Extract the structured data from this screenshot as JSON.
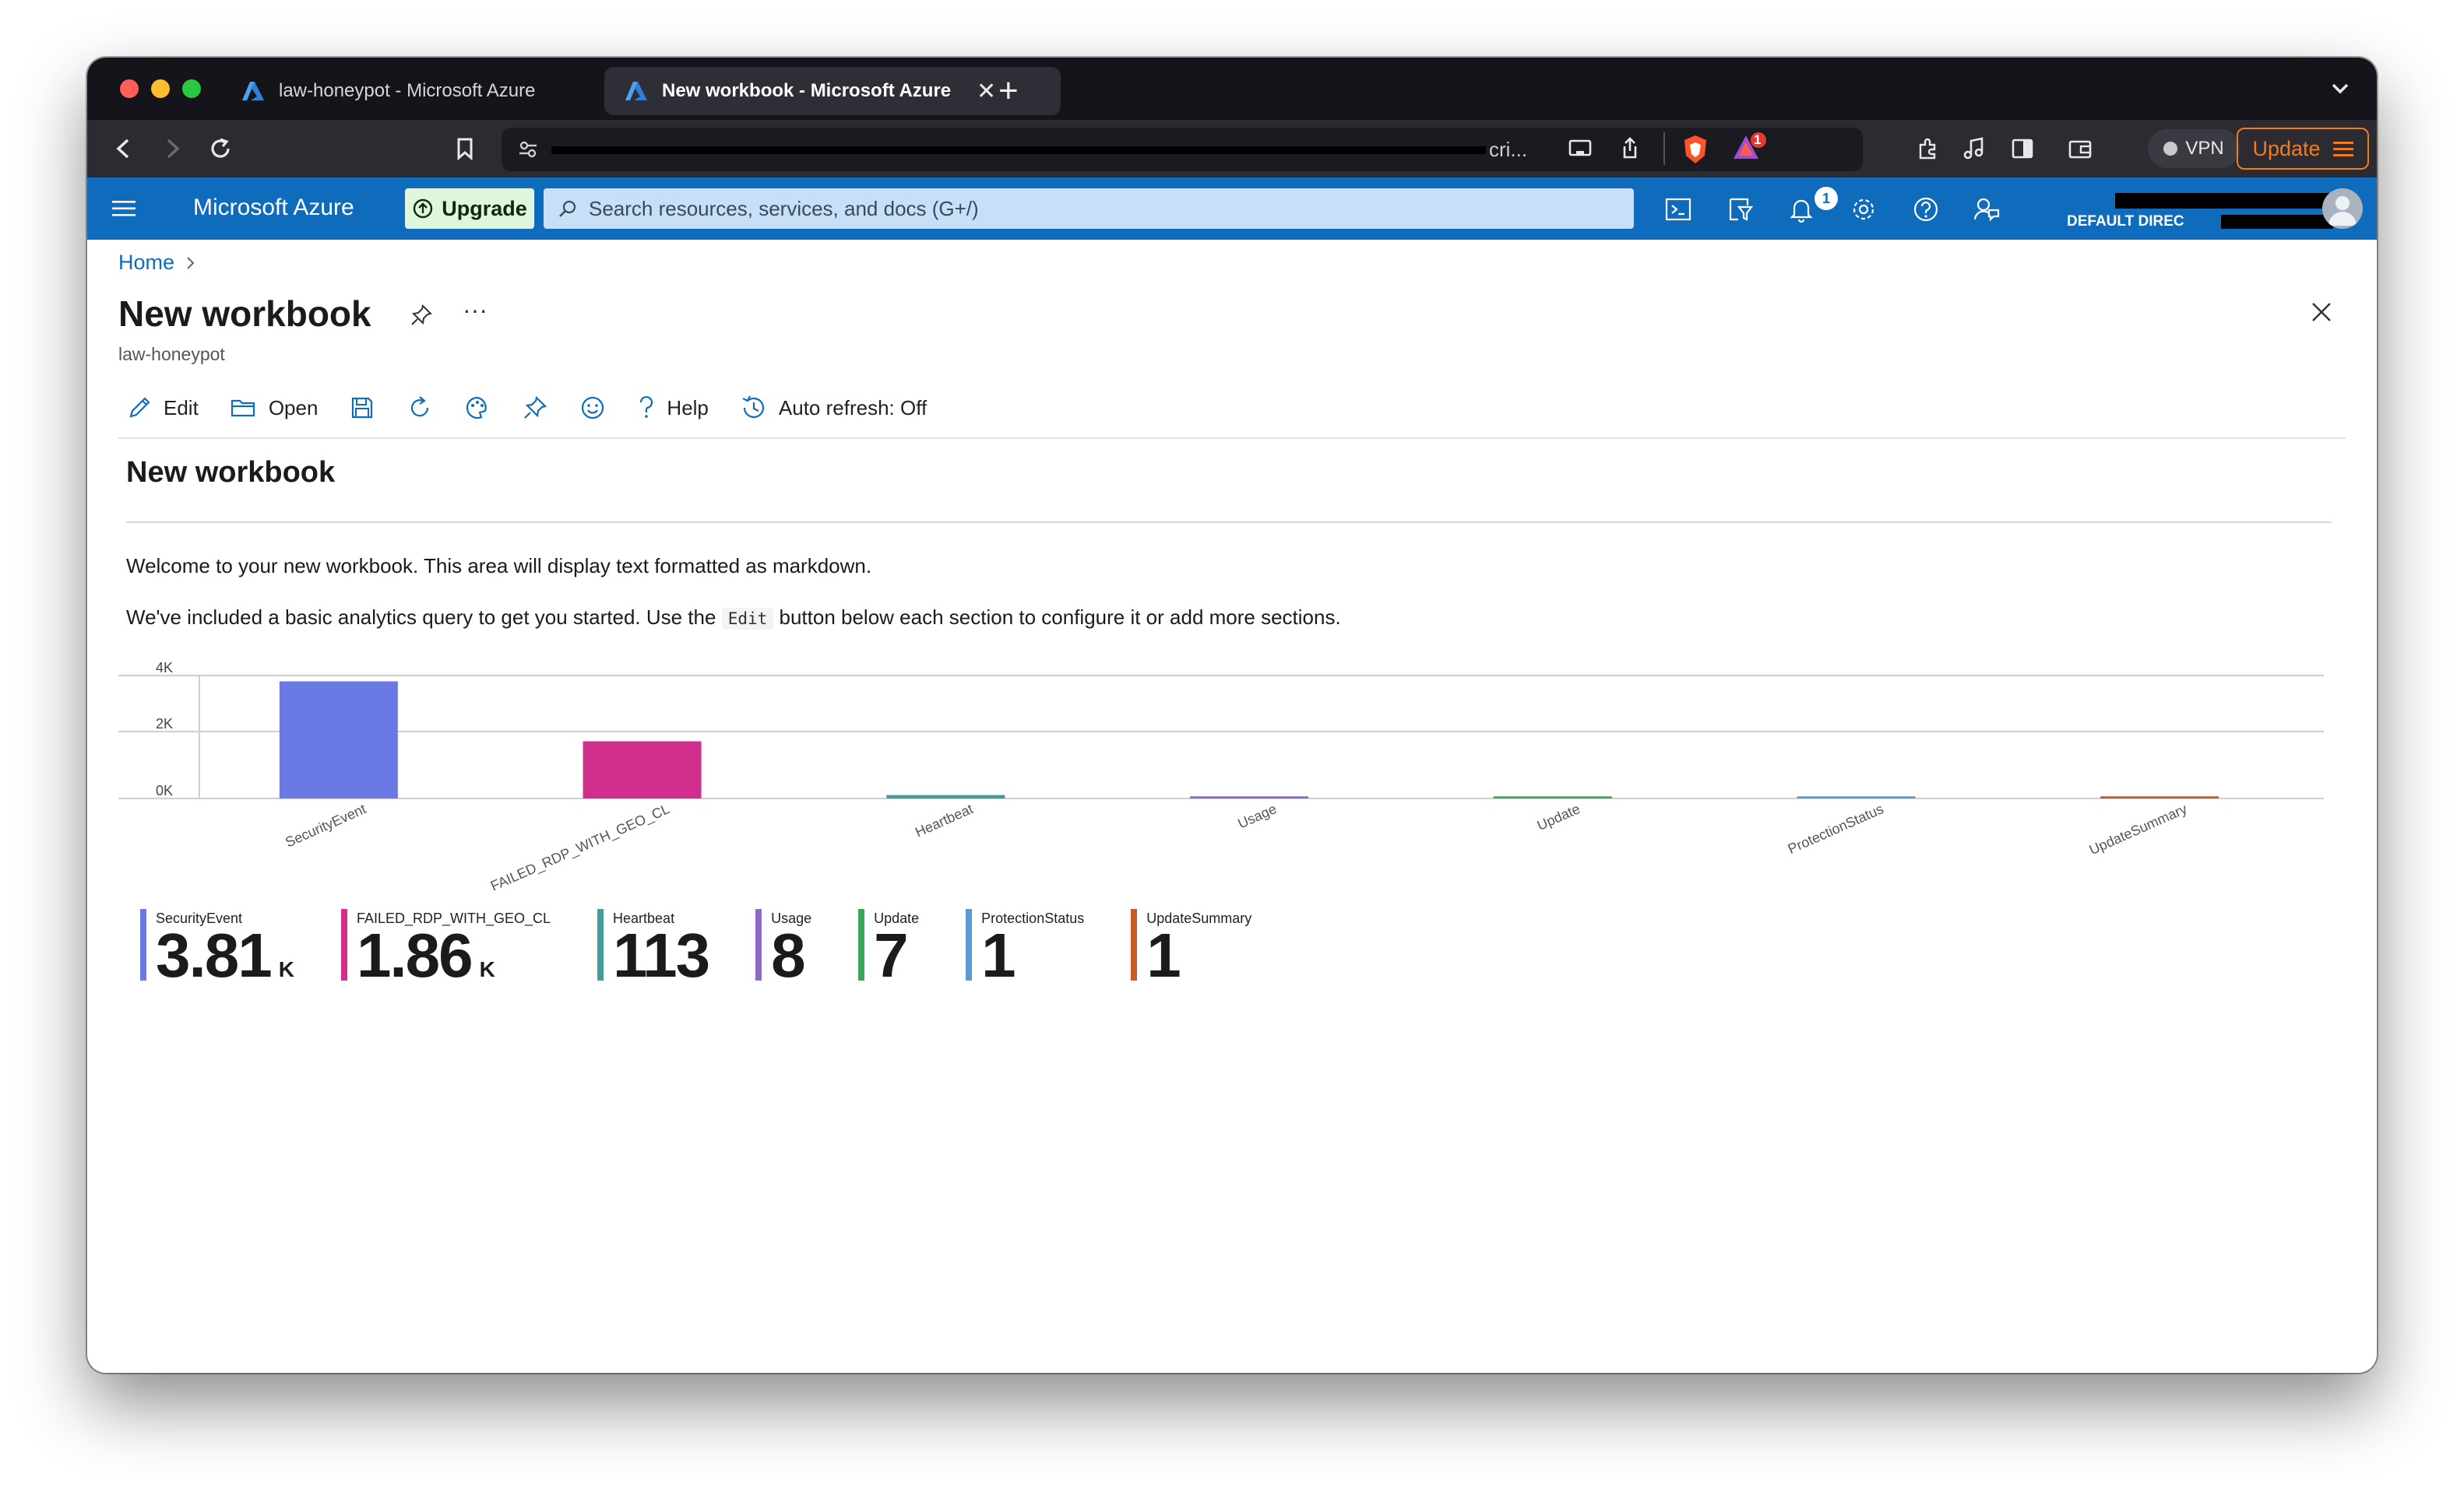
{
  "browser": {
    "tabs": [
      {
        "title": "law-honeypot - Microsoft Azure",
        "active": false
      },
      {
        "title": "New workbook - Microsoft Azure",
        "active": true
      }
    ],
    "url_tail": "cri...",
    "vpn_label": "VPN",
    "update_label": "Update",
    "shield_badge": "1"
  },
  "azure": {
    "brand": "Microsoft Azure",
    "upgrade_label": "Upgrade",
    "search_placeholder": "Search resources, services, and docs (G+/)",
    "notification_count": "1",
    "directory_label": "DEFAULT DIREC"
  },
  "page": {
    "breadcrumb_home": "Home",
    "title": "New workbook",
    "subtitle": "law-honeypot",
    "more": "···"
  },
  "toolbar": {
    "edit": "Edit",
    "open": "Open",
    "help": "Help",
    "auto_refresh": "Auto refresh: Off"
  },
  "workbook": {
    "heading": "New workbook",
    "p1": "Welcome to your new workbook. This area will display text formatted as markdown.",
    "p2_before": "We've included a basic analytics query to get you started. Use the",
    "p2_code": "Edit",
    "p2_after": "button below each section to configure it or add more sections."
  },
  "chart_data": {
    "type": "bar",
    "categories": [
      "SecurityEvent",
      "FAILED_RDP_WITH_GEO_CL",
      "Heartbeat",
      "Usage",
      "Update",
      "ProtectionStatus",
      "UpdateSummary"
    ],
    "values": [
      3810,
      1860,
      113,
      8,
      7,
      1,
      1
    ],
    "colors": [
      "#6b79e4",
      "#d12f8e",
      "#3f9e9a",
      "#8f69c8",
      "#3aa65a",
      "#5b9bd5",
      "#c75a26"
    ],
    "yticks": [
      "4K",
      "2K",
      "0K"
    ],
    "ylim": [
      0,
      4000
    ]
  },
  "tiles": [
    {
      "label": "SecurityEvent",
      "value": "3.81",
      "unit": "K",
      "color": "#6b79e4"
    },
    {
      "label": "FAILED_RDP_WITH_GEO_CL",
      "value": "1.86",
      "unit": "K",
      "color": "#d12f8e"
    },
    {
      "label": "Heartbeat",
      "value": "113",
      "unit": "",
      "color": "#3f9e9a"
    },
    {
      "label": "Usage",
      "value": "8",
      "unit": "",
      "color": "#8f69c8"
    },
    {
      "label": "Update",
      "value": "7",
      "unit": "",
      "color": "#3aa65a"
    },
    {
      "label": "ProtectionStatus",
      "value": "1",
      "unit": "",
      "color": "#5b9bd5"
    },
    {
      "label": "UpdateSummary",
      "value": "1",
      "unit": "",
      "color": "#c75a26"
    }
  ]
}
